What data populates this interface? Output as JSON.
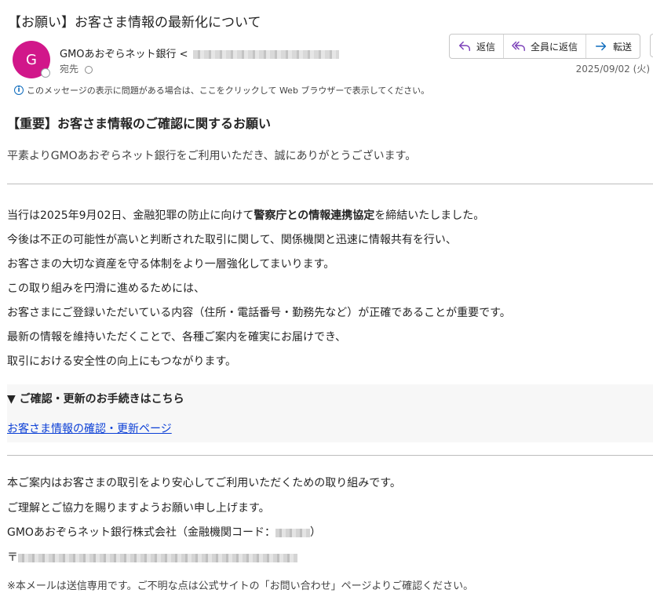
{
  "email": {
    "subject": "【お願い】お客さま情報の最新化について",
    "avatar_initial": "G",
    "sender_name": "GMOあおぞらネット銀行",
    "sender_addr_prefix": "<",
    "to_label": "宛先",
    "date": "2025/09/02 (火)",
    "info_bar": "このメッセージの表示に問題がある場合は、ここをクリックして Web ブラウザーで表示してください。"
  },
  "actions": {
    "reply": "返信",
    "reply_all": "全員に返信",
    "forward": "転送"
  },
  "content": {
    "heading": "【重要】お客さま情報のご確認に関するお願い",
    "greeting": "平素よりGMOあおぞらネット銀行をご利用いただき、誠にありがとうございます。",
    "p1_pre": "当行は2025年9月02日、金融犯罪の防止に向けて",
    "p1_bold": "警察庁との情報連携協定",
    "p1_post": "を締結いたしました。",
    "p2": "今後は不正の可能性が高いと判断された取引に関して、関係機関と迅速に情報共有を行い、",
    "p3": "お客さまの大切な資産を守る体制をより一層強化してまいります。",
    "p4": "この取り組みを円滑に進めるためには、",
    "p5": "お客さまにご登録いただいている内容（住所・電話番号・勤務先など）が正確であることが重要です。",
    "p6": "最新の情報を維持いただくことで、各種ご案内を確実にお届けでき、",
    "p7": "取引における安全性の向上にもつながります。",
    "box_title": "▼ ご確認・更新のお手続きはこちら",
    "link": "お客さま情報の確認・更新ページ",
    "f1": "本ご案内はお客さまの取引をより安心してご利用いただくための取り組みです。",
    "f2": "ご理解とご協力を賜りますようお願い申し上げます。",
    "f3_pre": "GMOあおぞらネット銀行株式会社（金融機関コード：",
    "f3_post": "）",
    "f4_pre": "〒",
    "f5": "※本メールは送信専用です。ご不明な点は公式サイトの「お問い合わせ」ページよりご確認ください。"
  },
  "colors": {
    "avatar": "#d1178a",
    "link": "#0b3fd6",
    "accent": "#0f6cbd"
  },
  "icons": {
    "reply": "reply-icon",
    "reply_all": "reply-all-icon",
    "forward": "forward-icon",
    "info": "info-icon"
  }
}
